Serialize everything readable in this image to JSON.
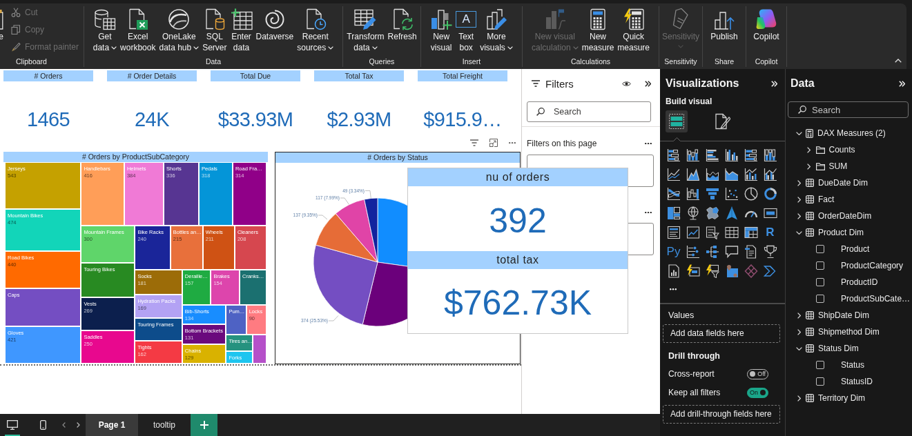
{
  "ribbon": {
    "groups": [
      {
        "label": "Clipboard",
        "buttons": [
          {
            "label": "e",
            "kind": "large",
            "disabled": false,
            "dropdown": false
          },
          {
            "label": "Cut",
            "kind": "small",
            "disabled": true,
            "dropdown": false
          },
          {
            "label": "Copy",
            "kind": "small",
            "disabled": true,
            "dropdown": false
          },
          {
            "label": "Format painter",
            "kind": "small",
            "disabled": true,
            "dropdown": false
          }
        ]
      },
      {
        "label": "Data",
        "buttons": [
          {
            "label": "Get\ndata",
            "kind": "large",
            "disabled": false,
            "dropdown": true
          },
          {
            "label": "Excel\nworkbook",
            "kind": "large",
            "disabled": false,
            "dropdown": false
          },
          {
            "label": "OneLake\ndata hub",
            "kind": "large",
            "disabled": false,
            "dropdown": true
          },
          {
            "label": "SQL\nServer",
            "kind": "large",
            "disabled": false,
            "dropdown": false
          },
          {
            "label": "Enter\ndata",
            "kind": "large",
            "disabled": false,
            "dropdown": false
          },
          {
            "label": "Dataverse",
            "kind": "large",
            "disabled": false,
            "dropdown": false
          },
          {
            "label": "Recent\nsources",
            "kind": "large",
            "disabled": false,
            "dropdown": true
          }
        ]
      },
      {
        "label": "Queries",
        "buttons": [
          {
            "label": "Transform\ndata",
            "kind": "large",
            "disabled": false,
            "dropdown": true
          },
          {
            "label": "Refresh",
            "kind": "large",
            "disabled": false,
            "dropdown": false
          }
        ]
      },
      {
        "label": "Insert",
        "buttons": [
          {
            "label": "New\nvisual",
            "kind": "large",
            "disabled": false,
            "dropdown": false
          },
          {
            "label": "Text\nbox",
            "kind": "large",
            "disabled": false,
            "dropdown": false,
            "glyph": "A"
          },
          {
            "label": "More\nvisuals",
            "kind": "large",
            "disabled": false,
            "dropdown": true
          }
        ]
      },
      {
        "label": "Calculations",
        "buttons": [
          {
            "label": "New visual\ncalculation",
            "kind": "large",
            "disabled": true,
            "dropdown": true
          },
          {
            "label": "New\nmeasure",
            "kind": "large",
            "disabled": false,
            "dropdown": false
          },
          {
            "label": "Quick\nmeasure",
            "kind": "large",
            "disabled": false,
            "dropdown": false
          }
        ]
      },
      {
        "label": "Sensitivity",
        "buttons": [
          {
            "label": "Sensitivity",
            "kind": "large",
            "disabled": true,
            "dropdown": true
          }
        ]
      },
      {
        "label": "Share",
        "buttons": [
          {
            "label": "Publish",
            "kind": "large",
            "disabled": false,
            "dropdown": false
          }
        ]
      },
      {
        "label": "Copilot",
        "buttons": [
          {
            "label": "Copilot",
            "kind": "large",
            "disabled": false,
            "dropdown": false
          }
        ]
      }
    ]
  },
  "canvas": {
    "cards": [
      {
        "title": "# Orders",
        "value": "1465"
      },
      {
        "title": "# Order Details",
        "value": "24K"
      },
      {
        "title": "Total Due",
        "value": "$33.93M"
      },
      {
        "title": "Total Tax",
        "value": "$2.93M"
      },
      {
        "title": "Total Freight",
        "value": "$915.9…"
      }
    ],
    "treemap": {
      "title": "# Orders by ProductSubCategory",
      "tiles": [
        {
          "label": "Jerseys",
          "value": "543",
          "color": "#c5a100"
        },
        {
          "label": "Mountain Bikes",
          "value": "474",
          "color": "#12d5b9"
        },
        {
          "label": "Road Bikes",
          "value": "440",
          "color": "#ff6a00"
        },
        {
          "label": "Caps",
          "color": "#744ec2"
        },
        {
          "label": "Gloves",
          "value": "421",
          "color": "#3f97ff"
        },
        {
          "label": "Handlebars",
          "value": "416",
          "color": "#ff9e58"
        },
        {
          "label": "Helmets",
          "value": "384",
          "color": "#f07ad6"
        },
        {
          "label": "Shorts",
          "value": "336",
          "color": "#573592"
        },
        {
          "label": "Pedals",
          "value": "318",
          "color": "#0495d8"
        },
        {
          "label": "Road Fra…",
          "value": "314",
          "color": "#900088"
        },
        {
          "label": "Mountain Frames",
          "value": "300",
          "color": "#5fd56a"
        },
        {
          "label": "Touring Bikes",
          "color": "#288a22"
        },
        {
          "label": "Vests",
          "value": "269",
          "color": "#0c1f4d"
        },
        {
          "label": "Saddles",
          "value": "250",
          "color": "#e8088e"
        },
        {
          "label": "Bike Racks",
          "value": "240",
          "color": "#1a2599"
        },
        {
          "label": "Bottles an…",
          "value": "215",
          "color": "#e8703b"
        },
        {
          "label": "Wheels",
          "value": "211",
          "color": "#cf5214"
        },
        {
          "label": "Cleaners",
          "value": "208",
          "color": "#d6474f"
        },
        {
          "label": "Socks",
          "value": "181",
          "color": "#9c6c08"
        },
        {
          "label": "Hydration Packs",
          "value": "169",
          "color": "#b3a2f4"
        },
        {
          "label": "Touring Frames",
          "color": "#0d4c8b"
        },
        {
          "label": "Tights",
          "value": "162",
          "color": "#f43a44"
        },
        {
          "label": "Deraille…",
          "value": "157",
          "color": "#1fab42"
        },
        {
          "label": "Brakes",
          "value": "154",
          "color": "#dd45ac"
        },
        {
          "label": "Cranks…",
          "color": "#1b7070"
        },
        {
          "label": "Bib-Shorts",
          "value": "134",
          "color": "#188dff"
        },
        {
          "label": "Bottom Brackets",
          "value": "131",
          "color": "#6a0a7d"
        },
        {
          "label": "Chains",
          "value": "129",
          "color": "#d9b200"
        },
        {
          "label": "Pum…",
          "color": "#4e62c4"
        },
        {
          "label": "Locks",
          "value": "90",
          "color": "#ff7b81"
        },
        {
          "label": "Tires an…",
          "color": "#25927f"
        },
        {
          "label": "Forks",
          "color": "#1ec5ef"
        },
        {
          "color": "#b550c9"
        }
      ]
    },
    "pie": {
      "title": "# Orders by Status",
      "slice_labels": [
        "49 (3.34%)",
        "117 (7.99%)",
        "137 (9.35%)",
        "374 (25.53%)"
      ]
    }
  },
  "tooltip": {
    "sections": [
      {
        "title": "nu of orders",
        "value": "392"
      },
      {
        "title": "total tax",
        "value": "$762.73K"
      }
    ]
  },
  "filters": {
    "title": "Filters",
    "search": {
      "placeholder": "Search"
    },
    "section": "Filters on this page"
  },
  "visualizations": {
    "title": "Visualizations",
    "subtitle": "Build visual",
    "modes": [
      {
        "selected": true
      },
      {
        "selected": false
      }
    ],
    "script_glyphs": [
      "R",
      "Py"
    ],
    "values_label": "Values",
    "values_drop": "Add data fields here",
    "drill": {
      "title": "Drill through",
      "options": [
        {
          "label": "Cross-report",
          "on": false,
          "state": "Off"
        },
        {
          "label": "Keep all filters",
          "on": true,
          "state": "On"
        }
      ],
      "drop": "Add drill-through fields here"
    }
  },
  "data": {
    "title": "Data",
    "search": {
      "placeholder": "Search"
    },
    "tree": [
      {
        "label": "DAX Measures (2)",
        "kind": "measures",
        "expanded": true,
        "children": [
          {
            "label": "Counts",
            "kind": "folder",
            "expanded": false
          },
          {
            "label": "SUM",
            "kind": "folder",
            "expanded": false
          }
        ]
      },
      {
        "label": "DueDate Dim",
        "kind": "table",
        "expanded": false
      },
      {
        "label": "Fact",
        "kind": "table",
        "expanded": false
      },
      {
        "label": "OrderDateDim",
        "kind": "table",
        "expanded": false
      },
      {
        "label": "Product Dim",
        "kind": "table",
        "expanded": true,
        "children": [
          {
            "label": "Product",
            "kind": "field",
            "checked": false
          },
          {
            "label": "ProductCategory",
            "kind": "field",
            "checked": false
          },
          {
            "label": "ProductID",
            "kind": "field",
            "checked": false
          },
          {
            "label": "ProductSubCate…",
            "kind": "field",
            "checked": false
          }
        ]
      },
      {
        "label": "ShipDate Dim",
        "kind": "table",
        "expanded": false
      },
      {
        "label": "Shipmethod Dim",
        "kind": "table",
        "expanded": false
      },
      {
        "label": "Status Dim",
        "kind": "table",
        "expanded": true,
        "children": [
          {
            "label": "Status",
            "kind": "field",
            "checked": false
          },
          {
            "label": "StatusID",
            "kind": "field",
            "checked": false
          }
        ]
      },
      {
        "label": "Territory Dim",
        "kind": "table",
        "expanded": false
      }
    ]
  },
  "pages": {
    "views": [
      {
        "selected": true
      },
      {
        "selected": false
      }
    ],
    "tabs": [
      {
        "label": "Page 1",
        "selected": true
      },
      {
        "label": "tooltip",
        "selected": false
      }
    ]
  }
}
